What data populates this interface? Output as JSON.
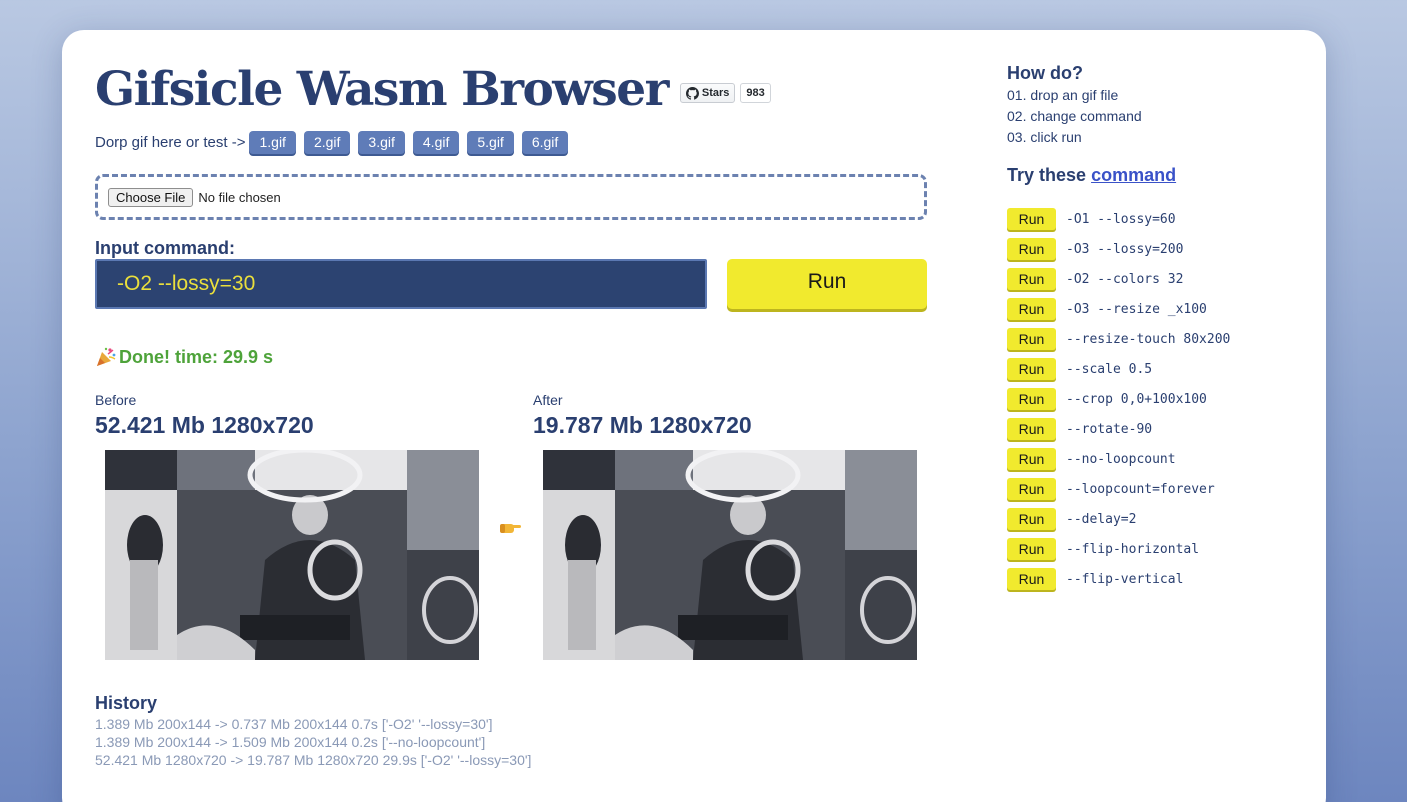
{
  "header": {
    "title": "Gifsicle Wasm Browser",
    "github_stars_label": "Stars",
    "github_stars_count": "983"
  },
  "test": {
    "label": "Dorp gif here or test ->",
    "gifs": [
      "1.gif",
      "2.gif",
      "3.gif",
      "4.gif",
      "5.gif",
      "6.gif"
    ]
  },
  "file_input": {
    "button_label": "Choose File",
    "status": "No file chosen"
  },
  "command": {
    "label": "Input command:",
    "value": "-O2 --lossy=30",
    "run_label": "Run"
  },
  "status": {
    "icon": "party-popper-icon",
    "text": "Done! time: 29.9 s"
  },
  "before": {
    "label": "Before",
    "info": "52.421 Mb 1280x720"
  },
  "after": {
    "label": "After",
    "info": "19.787 Mb 1280x720"
  },
  "arrow_icon": "pointing-hand-icon",
  "history": {
    "title": "History",
    "items": [
      "1.389 Mb 200x144 -> 0.737 Mb 200x144 0.7s ['-O2' '--lossy=30']",
      "1.389 Mb 200x144 -> 1.509 Mb 200x144 0.2s ['--no-loopcount']",
      "52.421 Mb 1280x720 -> 19.787 Mb 1280x720 29.9s ['-O2' '--lossy=30']"
    ]
  },
  "howto": {
    "title": "How do?",
    "steps": [
      "01. drop an gif file",
      "02. change command",
      "03. click run"
    ]
  },
  "try": {
    "title_prefix": "Try these",
    "title_link": "command",
    "run_label": "Run",
    "commands": [
      "-O1 --lossy=60",
      "-O3 --lossy=200",
      "-O2 --colors 32",
      "-O3 --resize _x100",
      "--resize-touch 80x200",
      "--scale 0.5",
      "--crop 0,0+100x100",
      "--rotate-90",
      "--no-loopcount",
      "--loopcount=forever",
      "--delay=2",
      "--flip-horizontal",
      "--flip-vertical"
    ]
  },
  "colors": {
    "accent_yellow": "#f1ea2e",
    "navy": "#2a3f70",
    "input_bg": "#2c4371",
    "success_green": "#4ea33a",
    "link_blue": "#3a52c8"
  }
}
